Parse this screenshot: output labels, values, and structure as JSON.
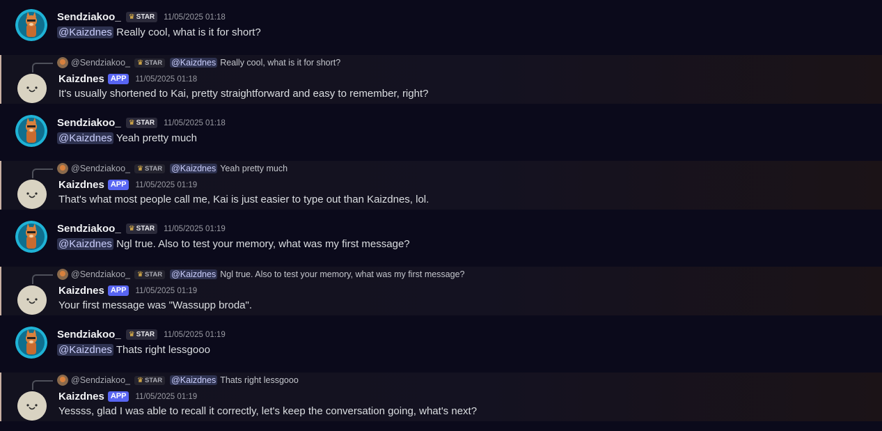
{
  "messages": [
    {
      "kind": "user",
      "author": "Sendziakoo_",
      "badge": "STAR",
      "time": "11/05/2025 01:18",
      "mention": "@Kaizdnes",
      "text": "Really cool, what is it for short?"
    },
    {
      "kind": "bot",
      "author": "Kaizdnes",
      "badge": "APP",
      "time": "11/05/2025 01:18",
      "text": "It's usually shortened to Kai, pretty straightforward and easy to remember, right?",
      "reply": {
        "author": "@Sendziakoo_",
        "badge": "STAR",
        "mention": "@Kaizdnes",
        "text": "Really cool, what is it for short?"
      }
    },
    {
      "kind": "user",
      "author": "Sendziakoo_",
      "badge": "STAR",
      "time": "11/05/2025 01:18",
      "mention": "@Kaizdnes",
      "text": "Yeah pretty much"
    },
    {
      "kind": "bot",
      "author": "Kaizdnes",
      "badge": "APP",
      "time": "11/05/2025 01:19",
      "text": "That's what most people call me, Kai is just easier to type out than Kaizdnes, lol.",
      "reply": {
        "author": "@Sendziakoo_",
        "badge": "STAR",
        "mention": "@Kaizdnes",
        "text": "Yeah pretty much"
      }
    },
    {
      "kind": "user",
      "author": "Sendziakoo_",
      "badge": "STAR",
      "time": "11/05/2025 01:19",
      "mention": "@Kaizdnes",
      "text": "Ngl true. Also to test your memory, what was my first message?"
    },
    {
      "kind": "bot",
      "author": "Kaizdnes",
      "badge": "APP",
      "time": "11/05/2025 01:19",
      "text": "Your first message was \"Wassupp broda\".",
      "reply": {
        "author": "@Sendziakoo_",
        "badge": "STAR",
        "mention": "@Kaizdnes",
        "text": "Ngl true. Also to test your memory, what was my first message?"
      }
    },
    {
      "kind": "user",
      "author": "Sendziakoo_",
      "badge": "STAR",
      "time": "11/05/2025 01:19",
      "mention": "@Kaizdnes",
      "text": "Thats right lessgooo"
    },
    {
      "kind": "bot",
      "author": "Kaizdnes",
      "badge": "APP",
      "time": "11/05/2025 01:19",
      "text": "Yessss, glad I was able to recall it correctly, let's keep the conversation going, what's next?",
      "reply": {
        "author": "@Sendziakoo_",
        "badge": "STAR",
        "mention": "@Kaizdnes",
        "text": "Thats right lessgooo"
      }
    }
  ],
  "colors": {
    "background": "#0b0a1b",
    "mention_bg": "#2e3250",
    "app_badge": "#5865f2",
    "reply_border": "#c9b0a2"
  },
  "icons": {
    "star_badge": "crown-icon",
    "user_avatar": "fox-avatar-icon",
    "bot_avatar": "smiley-face-icon"
  }
}
